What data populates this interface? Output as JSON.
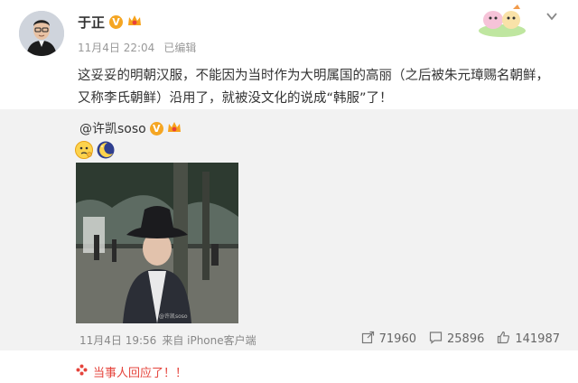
{
  "author": {
    "name": "于正",
    "badge": "V",
    "timestamp": "11月4日 22:04",
    "edited": "已编辑"
  },
  "post": {
    "text": "这妥妥的明朝汉服，不能因为当时作为大明属国的高丽（之后被朱元璋赐名朝鲜，又称李氏朝鲜）沿用了，就被没文化的说成“韩服”了！"
  },
  "repost": {
    "author": "@许凯soso",
    "badge": "V",
    "photo_watermark": "@许凯soso",
    "timestamp": "11月4日 19:56",
    "source": "来自 iPhone客户端",
    "stats": {
      "reposts": "71960",
      "comments": "25896",
      "likes": "141987"
    }
  },
  "tip": {
    "text": "当事人回应了！！"
  },
  "colors": {
    "accent": "#e5443c",
    "badge": "#f5a623",
    "repost_bg": "#f2f2f2"
  }
}
